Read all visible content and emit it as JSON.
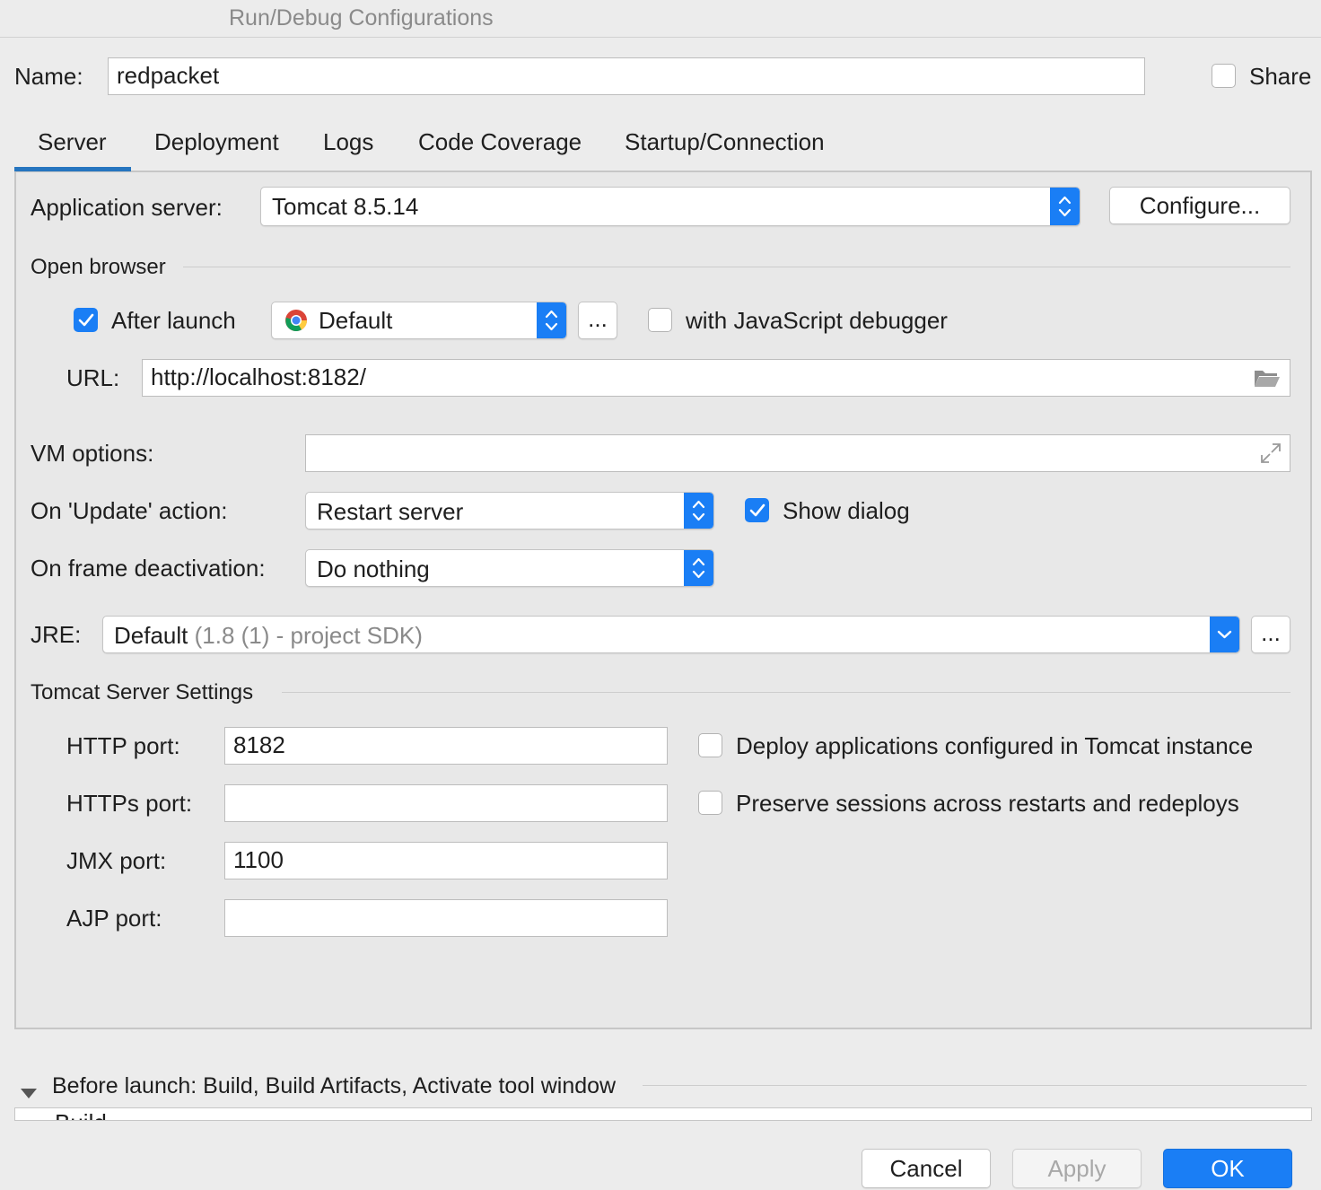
{
  "window": {
    "title": "Run/Debug Configurations"
  },
  "name_row": {
    "label": "Name:",
    "value": "redpacket",
    "share_label": "Share",
    "share_checked": false
  },
  "tabs": [
    {
      "label": "Server",
      "active": true
    },
    {
      "label": "Deployment",
      "active": false
    },
    {
      "label": "Logs",
      "active": false
    },
    {
      "label": "Code Coverage",
      "active": false
    },
    {
      "label": "Startup/Connection",
      "active": false
    }
  ],
  "server": {
    "app_server_label": "Application server:",
    "app_server_value": "Tomcat 8.5.14",
    "configure_label": "Configure...",
    "open_browser": {
      "section_label": "Open browser",
      "after_launch_label": "After launch",
      "after_launch_checked": true,
      "browser_value": "Default",
      "browser_icon": "chrome-icon",
      "more_label": "...",
      "js_debugger_label": "with JavaScript debugger",
      "js_debugger_checked": false,
      "url_label": "URL:",
      "url_value": "http://localhost:8182/",
      "url_icon": "folder-icon"
    },
    "vm_options": {
      "label": "VM options:",
      "value": "",
      "expand_icon": "expand-icon"
    },
    "update_action": {
      "label": "On 'Update' action:",
      "value": "Restart server",
      "show_dialog_label": "Show dialog",
      "show_dialog_checked": true
    },
    "frame_deactivation": {
      "label": "On frame deactivation:",
      "value": "Do nothing"
    },
    "jre": {
      "label": "JRE:",
      "value_main": "Default",
      "value_detail": "(1.8 (1) - project SDK)",
      "more_label": "..."
    },
    "tomcat_settings": {
      "section_label": "Tomcat Server Settings",
      "http_port_label": "HTTP port:",
      "http_port": "8182",
      "https_port_label": "HTTPs port:",
      "https_port": "",
      "jmx_port_label": "JMX port:",
      "jmx_port": "1100",
      "ajp_port_label": "AJP port:",
      "ajp_port": "",
      "deploy_label": "Deploy applications configured in Tomcat instance",
      "deploy_checked": false,
      "preserve_label": "Preserve sessions across restarts and redeploys",
      "preserve_checked": false
    }
  },
  "before_launch": {
    "label": "Before launch: Build, Build Artifacts, Activate tool window",
    "first_item": "Build"
  },
  "footer": {
    "cancel_label": "Cancel",
    "apply_label": "Apply",
    "ok_label": "OK"
  },
  "colors": {
    "accent": "#1a7ef5",
    "tab_underline": "#2675bf",
    "background": "#ececec"
  }
}
